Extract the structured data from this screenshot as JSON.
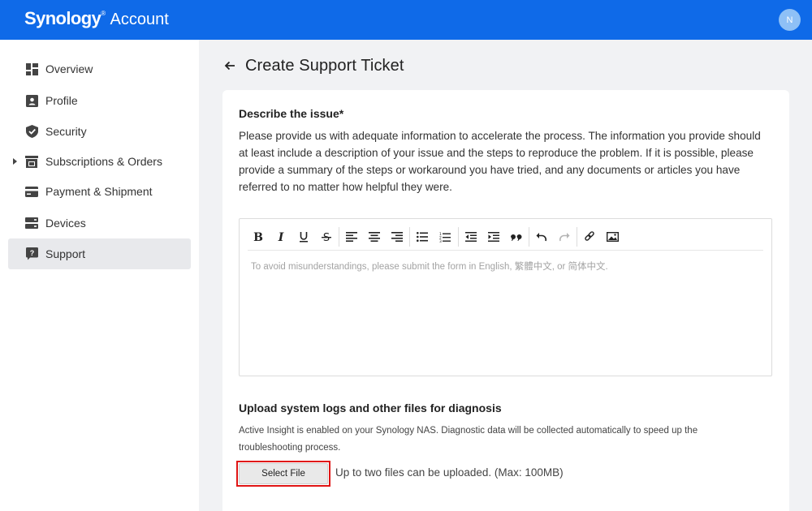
{
  "header": {
    "brand_logo": "Synology",
    "brand_mark": "®",
    "brand_sub": "Account",
    "avatar_initial": "N",
    "color": "#0f6ae8"
  },
  "sidebar": {
    "items": [
      {
        "label": "Overview",
        "icon": "grid-icon"
      },
      {
        "label": "Profile",
        "icon": "id-card-icon"
      },
      {
        "label": "Security",
        "icon": "shield-icon"
      },
      {
        "label": "Subscriptions & Orders",
        "icon": "store-icon"
      },
      {
        "label": "Payment & Shipment",
        "icon": "credit-card-icon"
      },
      {
        "label": "Devices",
        "icon": "server-icon"
      },
      {
        "label": "Support",
        "icon": "help-chat-icon",
        "active": true
      }
    ]
  },
  "main": {
    "title": "Create Support Ticket",
    "describe_title": "Describe the issue*",
    "describe_text": "Please provide us with adequate information to accelerate the process. The information you provide should at least include a description of your issue and the steps to reproduce the problem. If it is possible, please provide a summary of the steps or workaround you have tried, and any documents or articles you have referred to no matter how helpful they were.",
    "editor_placeholder": "To avoid misunderstandings, please submit the form in English, 繁體中文, or 简体中文.",
    "toolbar": [
      "bold",
      "italic",
      "underline",
      "strikethrough",
      "align-left",
      "align-center",
      "align-right",
      "bulleted-list",
      "numbered-list",
      "outdent",
      "indent",
      "blockquote",
      "undo",
      "redo",
      "link",
      "image"
    ],
    "upload_title": "Upload system logs and other files for diagnosis",
    "upload_hint": "Active Insight is enabled on your Synology NAS. Diagnostic data will be collected automatically to speed up the troubleshooting process.",
    "select_file_label": "Select File",
    "upload_note": "Up to two files can be uploaded. (Max: 100MB)"
  }
}
